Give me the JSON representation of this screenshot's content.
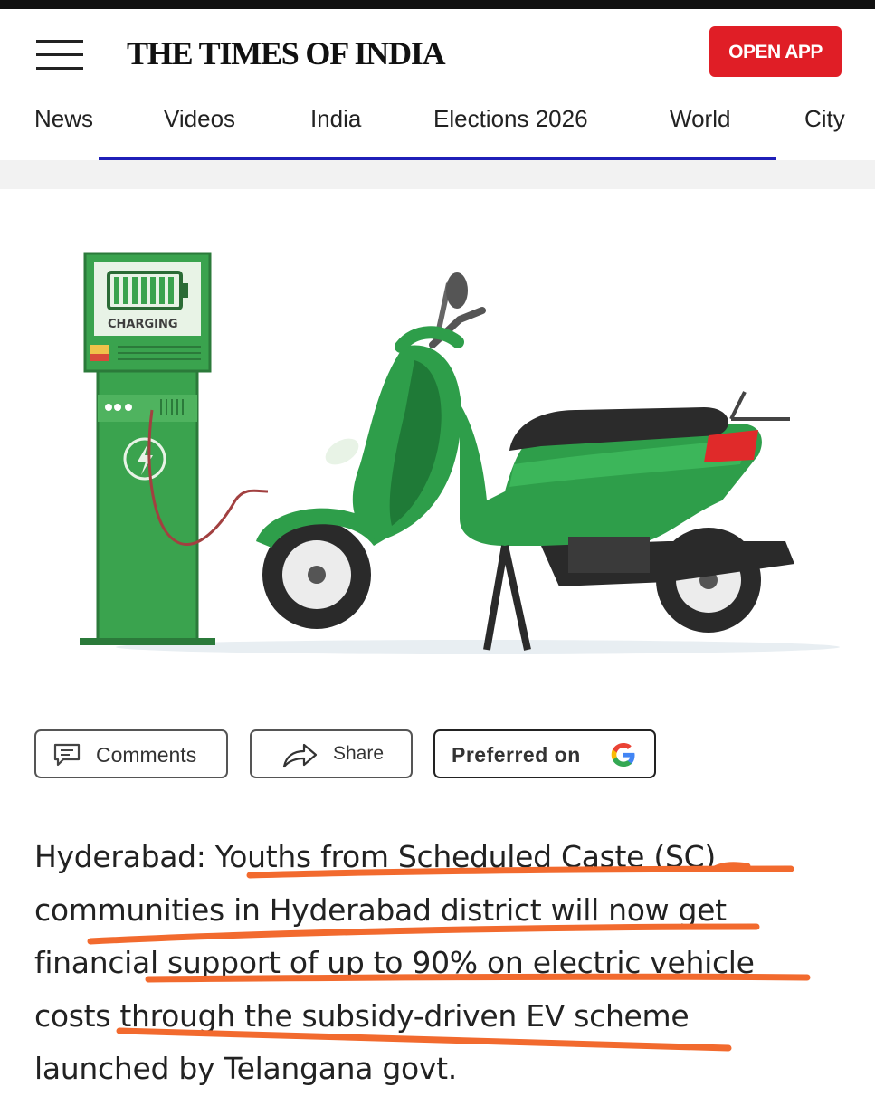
{
  "header": {
    "brand": "THE TIMES OF INDIA",
    "open_app_label": "OPEN APP"
  },
  "nav": {
    "items": [
      "News",
      "Videos",
      "India",
      "Elections 2026",
      "World",
      "City"
    ],
    "active": "Videos"
  },
  "hero": {
    "station_label": "CHARGING",
    "colors": {
      "scooter": "#2e9e4a",
      "station": "#3aa34e",
      "seat": "#2b2b2b",
      "tail_light": "#e02a2a"
    }
  },
  "actions": {
    "comments_label": "Comments",
    "share_label": "Share",
    "preferred_label": "Preferred on"
  },
  "article": {
    "lines": [
      "Hyderabad: Youths from Scheduled Caste (SC)",
      "communities in Hyderabad district will now get",
      "financial support of up to 90% on electric vehicle",
      "costs through the subsidy-driven EV scheme",
      "launched by Telangana govt."
    ],
    "highlight_color": "#f26a2e"
  },
  "colors": {
    "brand_red": "#e01e26",
    "nav_underline": "#1f1fb8"
  }
}
